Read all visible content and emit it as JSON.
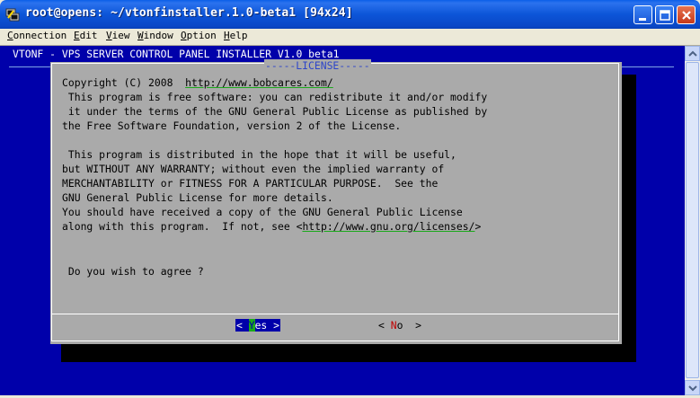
{
  "window": {
    "title": "root@opens: ~/vtonfinstaller.1.0-beta1 [94x24]"
  },
  "menubar": {
    "items": [
      {
        "hotkey": "C",
        "rest": "onnection"
      },
      {
        "hotkey": "E",
        "rest": "dit"
      },
      {
        "hotkey": "V",
        "rest": "iew"
      },
      {
        "hotkey": "W",
        "rest": "indow"
      },
      {
        "hotkey": "O",
        "rest": "ption"
      },
      {
        "hotkey": "H",
        "rest": "elp"
      }
    ]
  },
  "terminal": {
    "header": "VTONF - VPS SERVER CONTROL PANEL INSTALLER V1.0 beta1",
    "dialog": {
      "title": "-----LICENSE-----",
      "copyright_prefix": "Copyright (C) 2008  ",
      "copyright_link": "http://www.bobcares.com/",
      "lines_a": [
        " This program is free software: you can redistribute it and/or modify",
        " it under the terms of the GNU General Public License as published by",
        "the Free Software Foundation, version 2 of the License.",
        "",
        " This program is distributed in the hope that it will be useful,",
        "but WITHOUT ANY WARRANTY; without even the implied warranty of",
        "MERCHANTABILITY or FITNESS FOR A PARTICULAR PURPOSE.  See the",
        "GNU General Public License for more details.",
        "You should have received a copy of the GNU General Public License"
      ],
      "last_prefix": "along with this program.  If not, see <",
      "last_link": "http://www.gnu.org/licenses/",
      "last_suffix": ">",
      "prompt": " Do you wish to agree ?",
      "yes": {
        "left": "< ",
        "hotkey": "Y",
        "rest": "es >"
      },
      "no": {
        "left": "< ",
        "hotkey": "N",
        "rest": "o  >"
      }
    }
  },
  "colors": {
    "terminal_bg": "#0000AA",
    "dialog_bg": "#AAAAAA",
    "title_color": "#2E46C9",
    "hotkey_green": "#1BA91B",
    "hotkey_red": "#C00000"
  },
  "icons": {
    "app": "putty-terminal-icon",
    "minimize": "minimize-icon",
    "maximize": "maximize-icon",
    "close": "close-icon"
  }
}
